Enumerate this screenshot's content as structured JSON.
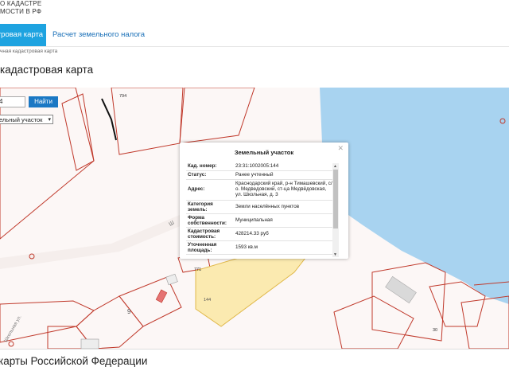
{
  "header": {
    "brand_line1": "О КАДАСТРЕ",
    "brand_line2": "МОСТИ В РФ"
  },
  "nav": {
    "tabs": [
      {
        "label": "стровая карта",
        "active": true
      },
      {
        "label": "Расчет земельного налога",
        "active": false
      }
    ]
  },
  "breadcrumb": "чная кадастровая карта",
  "page_title": "кадастровая карта",
  "search": {
    "value": "4",
    "button_label": "Найти",
    "type_selected": "ельный участок"
  },
  "map": {
    "labels": [
      "794",
      "771",
      "144",
      "9",
      "30"
    ],
    "street_labels": [
      "Ш",
      "Школьная ул."
    ],
    "colors": {
      "background": "#fcf7f6",
      "parcel_line": "#c0392b",
      "water": "#a8d3f0",
      "selected_parcel": "#fbeab0"
    }
  },
  "popup": {
    "title": "Земельный участок",
    "rows": [
      {
        "key": "Кад. номер:",
        "value": "23:31:1002005:144"
      },
      {
        "key": "Статус:",
        "value": "Ранее учтенный"
      },
      {
        "key": "Адрес:",
        "value": "Краснодарский край, р-н Тимашевский, с/о. Медведовский, ст-ца Медвёдовская, ул. Школьная, д. 3"
      },
      {
        "key": "Категория земель:",
        "value": "Земли населённых пунктов"
      },
      {
        "key": "Форма собственности:",
        "value": "Муниципальная"
      },
      {
        "key": "Кадастровая стоимость:",
        "value": "428214.33 руб"
      },
      {
        "key": "Уточненная площадь:",
        "value": "1593 кв.м"
      }
    ]
  },
  "bottom_title": "карты Российской Федерации"
}
